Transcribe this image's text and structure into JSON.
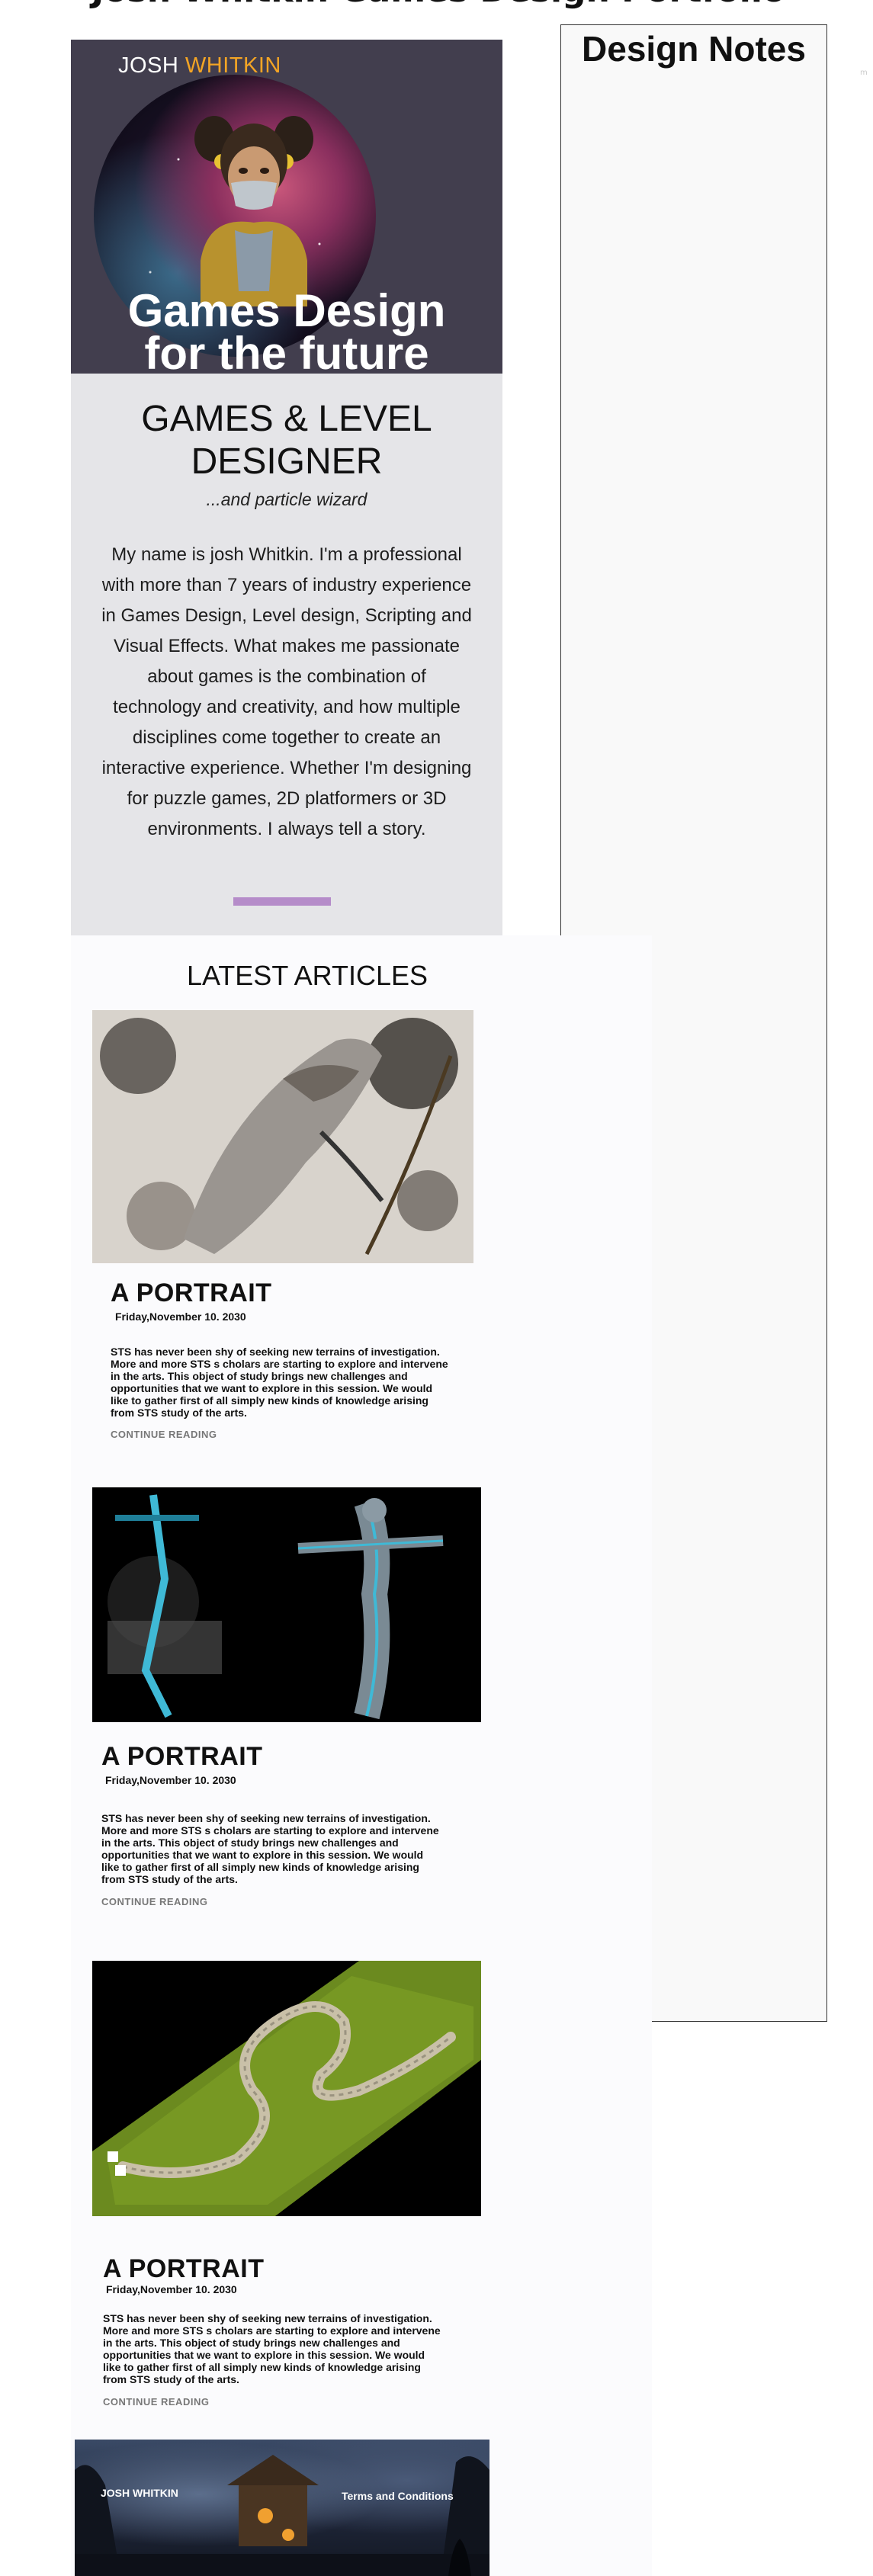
{
  "top_heading": "Josh Whitkin Games Design Portfolio",
  "hero": {
    "brand_first": "JOSH",
    "brand_last": "WHITKIN",
    "tagline_line1": "Games Design",
    "tagline_line2": "for the future",
    "accent_color": "#f2a425"
  },
  "intro": {
    "title_line1": "GAMES & LEVEL",
    "title_line2": "DESIGNER",
    "subtitle": "...and particle wizard",
    "bio_lines": [
      "My  name is josh Whitkin. I'm a professional",
      "with more than 7 years of industry experience",
      "in Games Design, Level design, Scripting and",
      "Visual Effects.  What makes me passionate",
      "about games is the combination of",
      "technology  and creativity, and how multiple",
      "disciplines come together to create an",
      "interactive experience. Whether I'm designing",
      "for puzzle games, 2D platformers or 3D",
      "environments. I always tell a story."
    ],
    "divider_color": "#b58cc9"
  },
  "sidebar": {
    "title": "Design Notes"
  },
  "articles": {
    "heading": "LATEST ARTICLES",
    "items": [
      {
        "image": "archer-sketch-image",
        "title": "A PORTRAIT",
        "date": "Friday,November 10. 2030",
        "excerpt_lines": [
          "STS has never been shy of seeking new terrains of  investigation.",
          "More and  more  STS s cholars are  starting to explore and intervene",
          "in the arts.  This object of study  brings  new challenges and",
          "opportunities that we want  to explore in this session.   We would",
          "like to gather first of all simply  new kinds of  knowledge arising",
          "from  STS study  of the arts."
        ],
        "link": "CONTINUE READING"
      },
      {
        "image": "neon-armor-figure-image",
        "title": "A PORTRAIT",
        "date": "Friday,November 10. 2030",
        "excerpt_lines": [
          "STS has never been shy of seeking new terrains of  investigation.",
          "More and  more  STS s cholars are  starting to explore and intervene",
          "in the arts.  This object of study  brings  new challenges and",
          "opportunities that we want  to explore in this session.   We would",
          "like to gather first of all simply  new kinds of  knowledge arising",
          "from  STS study  of the arts."
        ],
        "link": "CONTINUE READING"
      },
      {
        "image": "race-track-map-image",
        "title": "A PORTRAIT",
        "date": "Friday,November 10. 2030",
        "excerpt_lines": [
          "STS has never been shy of seeking new terrains of  investigation.",
          "More and  more  STS s cholars are  starting to explore and intervene",
          "in the arts.  This object of study  brings  new challenges and",
          "opportunities that we want  to explore in this session.   We would",
          "like to gather first of all simply  new kinds of  knowledge arising",
          "from  STS study  of the arts."
        ],
        "link": "CONTINUE READING"
      }
    ]
  },
  "footer": {
    "brand": "JOSH WHITKIN",
    "terms_link": "Terms and Conditions"
  }
}
